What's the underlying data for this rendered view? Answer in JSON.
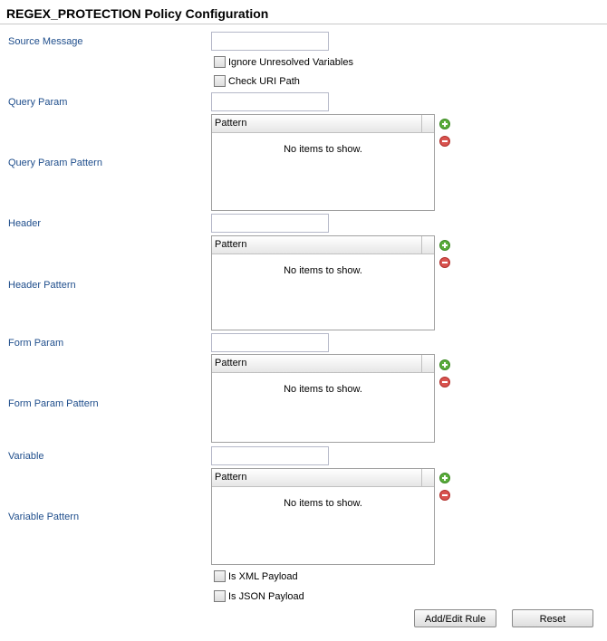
{
  "title": "REGEX_PROTECTION Policy Configuration",
  "labels": {
    "source_message": "Source Message",
    "query_param": "Query Param",
    "query_param_pattern": "Query Param Pattern",
    "header": "Header",
    "header_pattern": "Header Pattern",
    "form_param": "Form Param",
    "form_param_pattern": "Form Param Pattern",
    "variable": "Variable",
    "variable_pattern": "Variable Pattern"
  },
  "inputs": {
    "source_message": "",
    "query_param": "",
    "header": "",
    "form_param": "",
    "variable": ""
  },
  "checkboxes": {
    "ignore_unresolved": "Ignore Unresolved Variables",
    "check_uri_path": "Check URI Path",
    "is_xml_payload": "Is XML Payload",
    "is_json_payload": "Is JSON Payload"
  },
  "grid": {
    "column": "Pattern",
    "empty_text": "No items to show."
  },
  "buttons": {
    "add_edit_rule": "Add/Edit Rule",
    "reset": "Reset"
  },
  "colors": {
    "label": "#1f4e8c",
    "add_icon": "#5aad3b",
    "remove_icon": "#d9534f"
  }
}
